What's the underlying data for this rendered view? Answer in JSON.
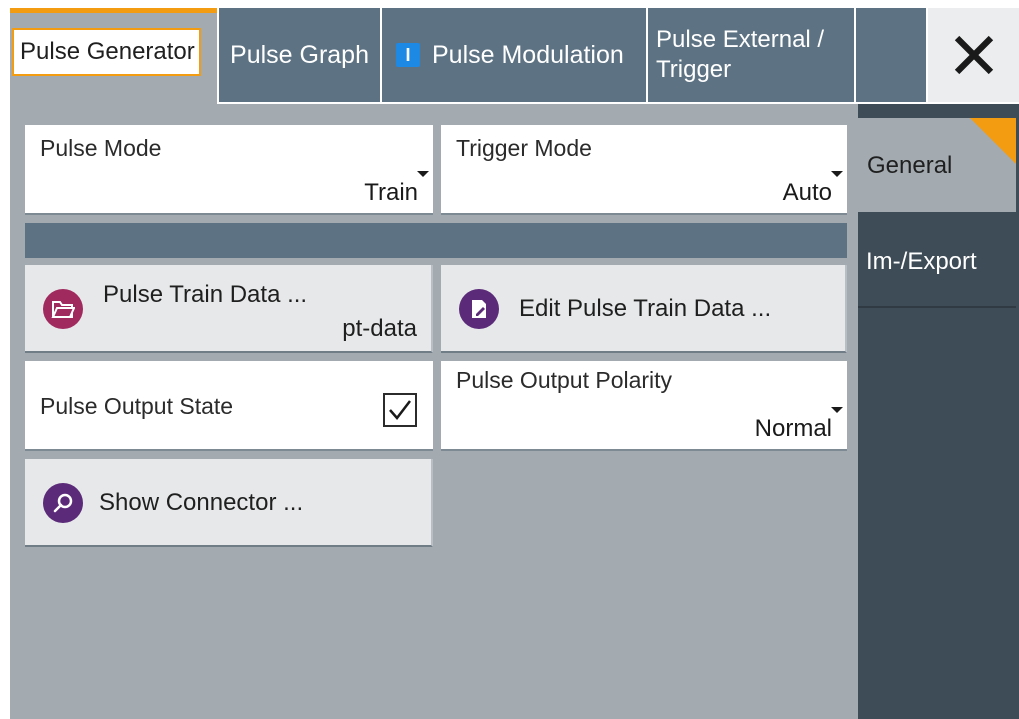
{
  "tabs": {
    "active_label": "Pulse Generator",
    "graph_label": "Pulse Graph",
    "modulation_badge": "I",
    "modulation_label": "Pulse Modulation",
    "external_line1": "Pulse External /",
    "external_line2": "Trigger"
  },
  "pulse_mode": {
    "label": "Pulse Mode",
    "value": "Train"
  },
  "trigger_mode": {
    "label": "Trigger Mode",
    "value": "Auto"
  },
  "pulse_train_data": {
    "label": "Pulse Train Data ...",
    "value": "pt-data",
    "icon": "folder-open-icon"
  },
  "edit_pulse_train": {
    "label": "Edit Pulse Train Data ...",
    "icon": "edit-document-icon"
  },
  "pulse_output_state": {
    "label": "Pulse Output State",
    "checked": true
  },
  "pulse_output_polarity": {
    "label": "Pulse Output Polarity",
    "value": "Normal"
  },
  "show_connector": {
    "label": "Show Connector ...",
    "icon": "search-icon"
  },
  "side_tabs": {
    "general": "General",
    "export": "Im-/Export"
  },
  "colors": {
    "accent": "#f39c12",
    "tab_bg": "#5d7384",
    "panel_bg": "#a3abb1",
    "side_dark": "#3e4c57",
    "icon_magenta": "#a0295e",
    "icon_purple": "#5b2a78",
    "badge_blue": "#1e88e5"
  }
}
